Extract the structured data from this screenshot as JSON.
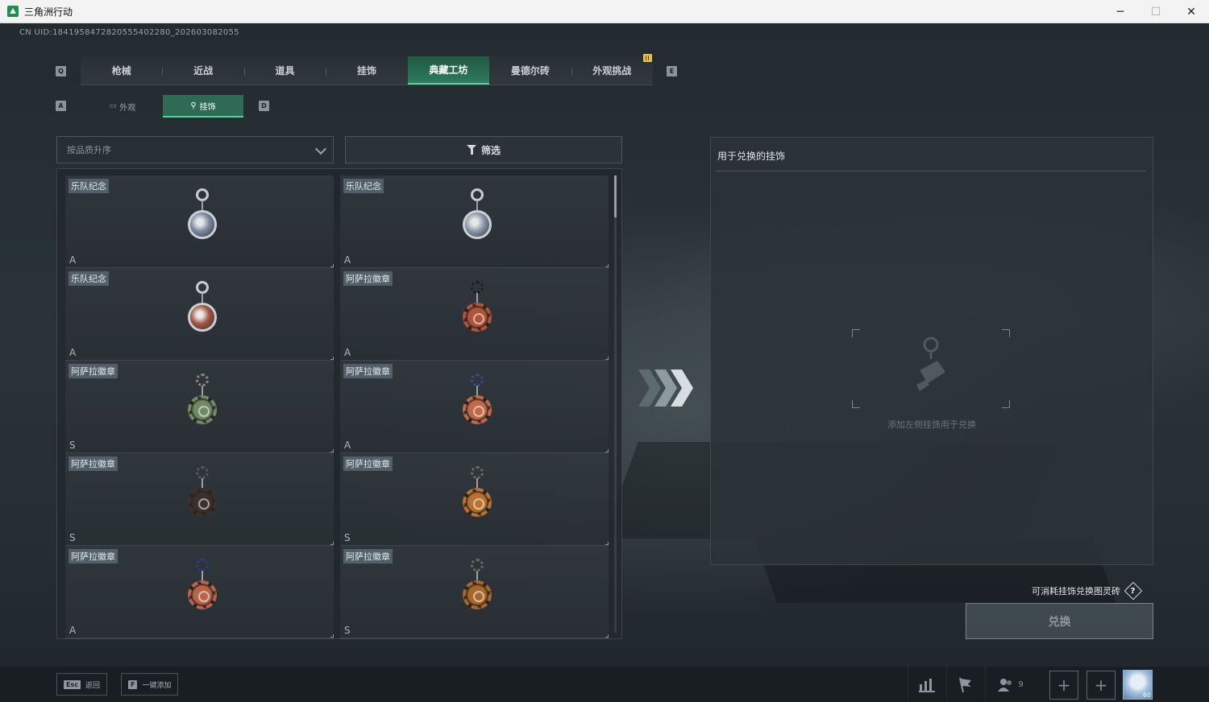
{
  "window": {
    "title": "三角洲行动",
    "minimize": "─",
    "maximize": "☐",
    "close": "✕"
  },
  "uid": "CN UID:1841958472820555402280_202603082055",
  "main_tabs": {
    "left_key": "Q",
    "right_key": "E",
    "items": [
      {
        "label": "枪械",
        "active": false
      },
      {
        "label": "近战",
        "active": false
      },
      {
        "label": "道具",
        "active": false
      },
      {
        "label": "挂饰",
        "active": false
      },
      {
        "label": "典藏工坊",
        "active": true
      },
      {
        "label": "曼德尔砖",
        "active": false
      },
      {
        "label": "外观挑战",
        "active": false
      }
    ]
  },
  "sub_tabs": {
    "left_key": "A",
    "right_key": "D",
    "items": [
      {
        "label": "外观",
        "icon": "appearance-icon",
        "active": false
      },
      {
        "label": "挂饰",
        "icon": "charm-icon",
        "active": true
      }
    ]
  },
  "sort": {
    "value": "按品质升序"
  },
  "filter": {
    "label": "筛选"
  },
  "items": [
    {
      "name": "乐队纪念",
      "rank": "A",
      "style": "round",
      "ring": "#c7ccd0",
      "medal": "#7c8aa0"
    },
    {
      "name": "乐队纪念",
      "rank": "A",
      "style": "round",
      "ring": "#c7ccd0",
      "medal": "#8c98a8"
    },
    {
      "name": "乐队纪念",
      "rank": "A",
      "style": "round",
      "ring": "#c7ccd0",
      "medal": "#a35440"
    },
    {
      "name": "阿萨拉徽章",
      "rank": "A",
      "style": "gear",
      "ring": "#1b1e21",
      "medal": "#b0543a"
    },
    {
      "name": "阿萨拉徽章",
      "rank": "S",
      "style": "gear",
      "ring": "#8f8a78",
      "medal": "#6f8a64"
    },
    {
      "name": "阿萨拉徽章",
      "rank": "A",
      "style": "gear",
      "ring": "#2f4f8f",
      "medal": "#c06a4a"
    },
    {
      "name": "阿萨拉徽章",
      "rank": "S",
      "style": "gear",
      "ring": "#5a5a58",
      "medal": "#3c302b"
    },
    {
      "name": "阿萨拉徽章",
      "rank": "S",
      "style": "gear",
      "ring": "#6e6a5c",
      "medal": "#b8742e"
    },
    {
      "name": "阿萨拉徽章",
      "rank": "A",
      "style": "gear",
      "ring": "#2a3f8a",
      "medal": "#b76448"
    },
    {
      "name": "阿萨拉徽章",
      "rank": "S",
      "style": "gear",
      "ring": "#6e6a5c",
      "medal": "#a8682a"
    }
  ],
  "right_panel": {
    "header": "用于兑换的挂饰",
    "empty_hint": "添加左侧挂饰用于兑换"
  },
  "exchange": {
    "info": "可消耗挂饰兑换图灵砖",
    "help": "?",
    "button": "兑换"
  },
  "bottom": {
    "back": {
      "key": "Esc",
      "label": "返回"
    },
    "add_all": {
      "key": "F",
      "label": "一键添加"
    },
    "friends_count": "9",
    "avatar_level": "60"
  },
  "colors": {
    "accent": "#4fd39a",
    "active_tab": "#2f7a5c"
  }
}
